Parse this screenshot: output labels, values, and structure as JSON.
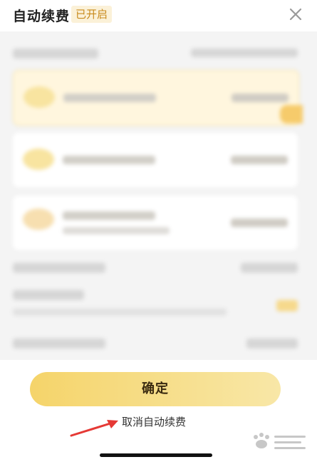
{
  "header": {
    "title": "自动续费",
    "status_badge": "已开启",
    "close_icon": "close-icon"
  },
  "actions": {
    "confirm_label": "确定",
    "cancel_auto_renew_label": "取消自动续费"
  },
  "annotation": {
    "arrow_color": "#e53935",
    "icon": "red-arrow-icon"
  },
  "watermark": {
    "icon": "baidu-jingyan-watermark-icon"
  },
  "colors": {
    "accent": "#f5d46a",
    "badge_text": "#c88a1d",
    "badge_bg": "#fbf1d8"
  }
}
